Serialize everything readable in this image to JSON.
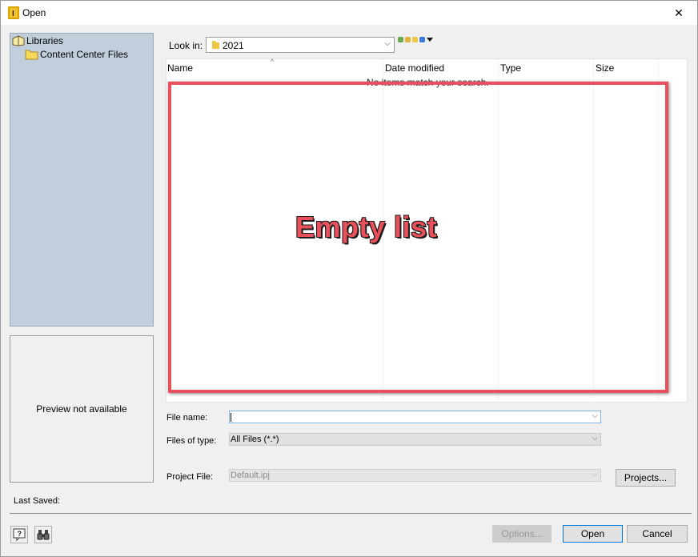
{
  "window": {
    "title": "Open",
    "close_glyph": "✕"
  },
  "places": {
    "items": [
      {
        "label": "Libraries",
        "icon": "libraries-icon"
      },
      {
        "label": "Content Center Files",
        "icon": "folder-icon"
      }
    ]
  },
  "preview": {
    "text": "Preview not available"
  },
  "lookin": {
    "label": "Look in:",
    "value": "2021"
  },
  "list": {
    "columns": [
      "Name",
      "Date modified",
      "Type",
      "Size"
    ],
    "sort_glyph": "^",
    "empty_message": "No items match your search."
  },
  "annotation": {
    "text": "Empty list",
    "color": "#e8505b"
  },
  "form": {
    "file_name_label": "File name:",
    "file_name_value": "",
    "files_of_type_label": "Files of type:",
    "files_of_type_value": "All Files (*.*)",
    "project_file_label": "Project File:",
    "project_file_value": "Default.ipj"
  },
  "buttons": {
    "projects": "Projects...",
    "options": "Options...",
    "open": "Open",
    "cancel": "Cancel"
  },
  "status": {
    "last_saved_label": "Last Saved:"
  },
  "colors": {
    "places_bg": "#c1cfdc",
    "accent": "#0078d7"
  }
}
